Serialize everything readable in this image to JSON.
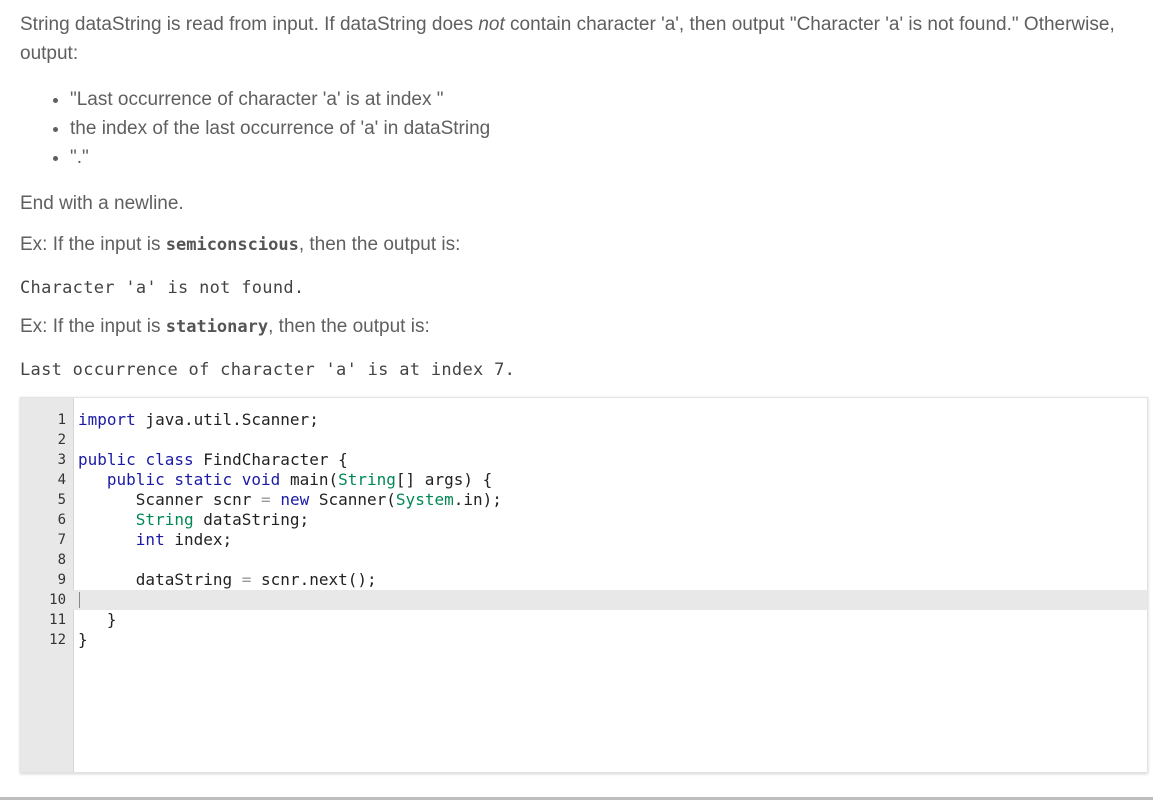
{
  "intro": {
    "part1": "String dataString is read from input. If dataString does ",
    "emph": "not",
    "part2": " contain character 'a', then output \"Character 'a' is not found.\" Otherwise, output:"
  },
  "requirements": [
    "\"Last occurrence of character 'a' is at index \"",
    "the index of the last occurrence of 'a' in dataString",
    "\".\""
  ],
  "end_note": "End with a newline.",
  "examples": [
    {
      "prefix": "Ex: If the input is ",
      "input": "semiconscious",
      "suffix": ", then the output is:",
      "output": "Character 'a' is not found."
    },
    {
      "prefix": "Ex: If the input is ",
      "input": "stationary",
      "suffix": ", then the output is:",
      "output": "Last occurrence of character 'a' is at index 7."
    }
  ],
  "editor": {
    "active_line": 10,
    "lines": [
      {
        "n": "1",
        "code": "import java.util.Scanner;"
      },
      {
        "n": "2",
        "code": ""
      },
      {
        "n": "3",
        "code": "public class FindCharacter {"
      },
      {
        "n": "4",
        "code": "   public static void main(String[] args) {"
      },
      {
        "n": "5",
        "code": "      Scanner scnr = new Scanner(System.in);"
      },
      {
        "n": "6",
        "code": "      String dataString;"
      },
      {
        "n": "7",
        "code": "      int index;"
      },
      {
        "n": "8",
        "code": ""
      },
      {
        "n": "9",
        "code": "      dataString = scnr.next();"
      },
      {
        "n": "10",
        "code": ""
      },
      {
        "n": "11",
        "code": "   }"
      },
      {
        "n": "12",
        "code": "}"
      }
    ]
  }
}
